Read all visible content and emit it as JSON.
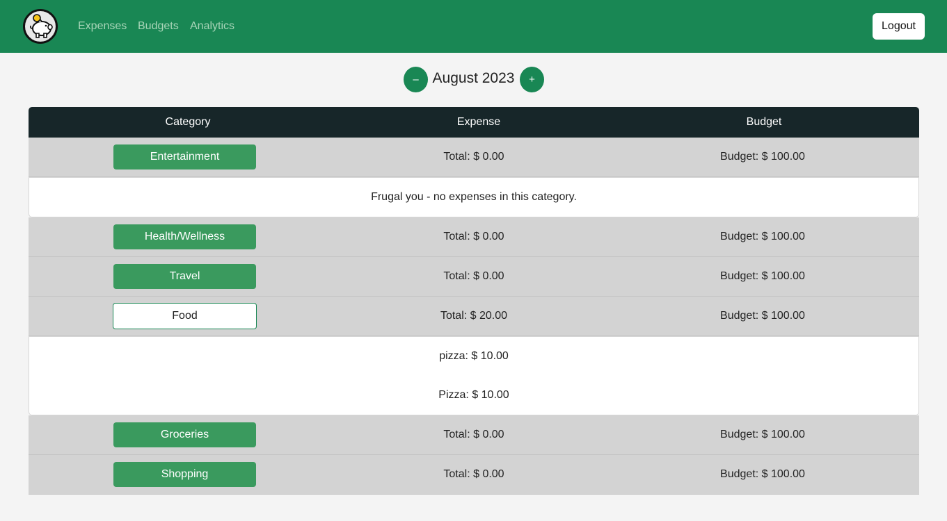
{
  "nav": {
    "links": [
      "Expenses",
      "Budgets",
      "Analytics"
    ],
    "logout_label": "Logout",
    "brand_color": "#198754"
  },
  "month": {
    "prev_label": "–",
    "next_label": "+",
    "current": "August 2023"
  },
  "table": {
    "headers": [
      "Category",
      "Expense",
      "Budget"
    ],
    "rows": [
      {
        "category": "Entertainment",
        "total": "Total: $ 0.00",
        "budget": "Budget: $ 100.00",
        "expanded": true,
        "details": [
          "Frugal you - no expenses in this category."
        ]
      },
      {
        "category": "Health/Wellness",
        "total": "Total: $ 0.00",
        "budget": "Budget: $ 100.00",
        "expanded": false
      },
      {
        "category": "Travel",
        "total": "Total: $ 0.00",
        "budget": "Budget: $ 100.00",
        "expanded": false
      },
      {
        "category": "Food",
        "total": "Total: $ 20.00",
        "budget": "Budget: $ 100.00",
        "expanded": true,
        "active": true,
        "details": [
          "pizza: $ 10.00",
          "Pizza: $ 10.00"
        ]
      },
      {
        "category": "Groceries",
        "total": "Total: $ 0.00",
        "budget": "Budget: $ 100.00",
        "expanded": false
      },
      {
        "category": "Shopping",
        "total": "Total: $ 0.00",
        "budget": "Budget: $ 100.00",
        "expanded": false
      }
    ]
  }
}
